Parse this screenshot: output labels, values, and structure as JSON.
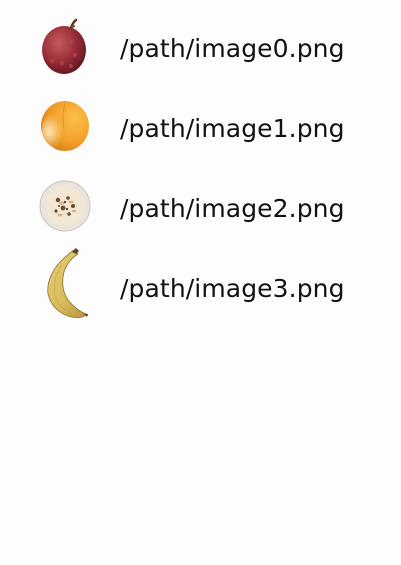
{
  "images": [
    {
      "path": "/path/image0.png",
      "icon": "lychee-icon"
    },
    {
      "path": "/path/image1.png",
      "icon": "apricot-icon"
    },
    {
      "path": "/path/image2.png",
      "icon": "oatmeal-bowl-icon"
    },
    {
      "path": "/path/image3.png",
      "icon": "banana-icon"
    }
  ]
}
